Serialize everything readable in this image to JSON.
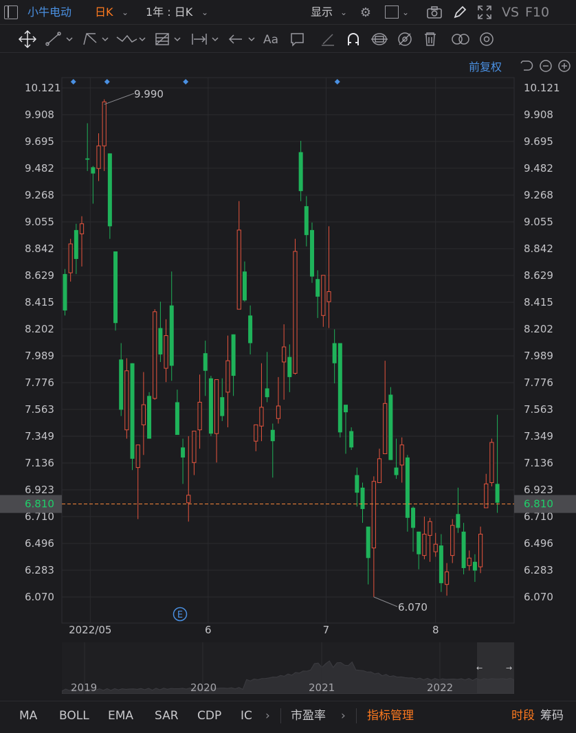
{
  "header": {
    "stock_name": "小牛电动",
    "period_label": "日K",
    "range_label": "1年 : 日K",
    "display_label": "显示",
    "vs_label": "VS",
    "f10_label": "F10",
    "adjust_label": "前复权"
  },
  "footer": {
    "tabs": [
      "MA",
      "BOLL",
      "EMA",
      "SAR",
      "CDP",
      "IC"
    ],
    "pe_label": "市盈率",
    "indicator_mgmt": "指标管理",
    "time_share": "时段",
    "chips": "筹码"
  },
  "navigator": {
    "year_labels": [
      "2019",
      "2020",
      "2021",
      "2022"
    ]
  },
  "colors": {
    "up": "#e8553e",
    "down": "#1fb35a",
    "price_line": "#ff8a3d",
    "accent": "#4a90e2"
  },
  "chart_data": {
    "type": "candlestick",
    "y_ticks": [
      "10.121",
      "9.908",
      "9.695",
      "9.482",
      "9.268",
      "9.055",
      "8.842",
      "8.629",
      "8.415",
      "8.202",
      "7.989",
      "7.776",
      "7.563",
      "7.349",
      "7.136",
      "6.923",
      "6.710",
      "6.496",
      "6.283",
      "6.070"
    ],
    "ylim": [
      5.88,
      10.17
    ],
    "x_labels": [
      "2022/05",
      "6",
      "7",
      "8"
    ],
    "x_label_index": [
      4.5,
      25.5,
      46.5,
      66
    ],
    "current_price": "6.810",
    "current_value": 6.81,
    "high_label": "9.990",
    "high_index": 7,
    "high_value": 9.99,
    "low_label": "6.070",
    "low_index": 55,
    "low_value": 6.07,
    "event_marker": "E",
    "event_index": 20.5,
    "dividend_markers": [
      1.5,
      7.5,
      21.5,
      48.5
    ],
    "candles": [
      [
        8.64,
        8.35,
        8.68,
        8.31
      ],
      [
        8.65,
        8.88,
        8.92,
        8.58
      ],
      [
        8.99,
        8.76,
        9.04,
        8.64
      ],
      [
        8.96,
        9.04,
        9.1,
        8.7
      ],
      [
        9.56,
        9.55,
        9.84,
        9.46
      ],
      [
        9.49,
        9.44,
        9.5,
        9.2
      ],
      [
        9.48,
        9.66,
        9.76,
        9.38
      ],
      [
        9.66,
        10.01,
        10.03,
        9.46
      ],
      [
        9.6,
        9.02,
        9.6,
        8.92
      ],
      [
        8.82,
        8.25,
        8.82,
        8.19
      ],
      [
        7.96,
        7.56,
        8.09,
        7.51
      ],
      [
        7.4,
        7.87,
        7.97,
        7.33
      ],
      [
        7.93,
        7.17,
        7.93,
        7.08
      ],
      [
        7.1,
        7.28,
        7.28,
        6.69
      ],
      [
        7.44,
        7.6,
        7.86,
        7.2
      ],
      [
        7.67,
        7.33,
        7.7,
        7.33
      ],
      [
        7.65,
        8.34,
        8.36,
        7.64
      ],
      [
        8.21,
        8.0,
        8.42,
        7.94
      ],
      [
        7.89,
        8.15,
        8.28,
        7.78
      ],
      [
        8.39,
        7.91,
        8.66,
        7.79
      ],
      [
        7.62,
        7.36,
        7.72,
        7.36
      ],
      [
        7.26,
        7.18,
        7.33,
        6.97
      ],
      [
        6.82,
        6.88,
        7.35,
        6.67
      ],
      [
        7.14,
        7.39,
        7.39,
        7.04
      ],
      [
        7.4,
        7.62,
        7.84,
        7.25
      ],
      [
        8.01,
        7.87,
        8.11,
        7.67
      ],
      [
        7.81,
        7.37,
        7.83,
        7.35
      ],
      [
        7.37,
        7.8,
        7.8,
        7.14
      ],
      [
        7.66,
        7.51,
        7.81,
        7.47
      ],
      [
        7.7,
        7.95,
        8.15,
        7.42
      ],
      [
        8.16,
        7.83,
        8.16,
        7.67
      ],
      [
        8.36,
        8.99,
        9.22,
        8.36
      ],
      [
        8.66,
        8.43,
        8.74,
        8.42
      ],
      [
        8.31,
        8.09,
        8.39,
        8.0
      ],
      [
        7.31,
        7.44,
        7.44,
        7.23
      ],
      [
        7.43,
        7.58,
        7.93,
        7.31
      ],
      [
        7.73,
        7.66,
        8.02,
        7.62
      ],
      [
        7.4,
        7.31,
        7.45,
        7.02
      ],
      [
        7.49,
        7.59,
        7.82,
        7.45
      ],
      [
        7.94,
        8.06,
        8.24,
        7.64
      ],
      [
        7.98,
        7.82,
        8.08,
        7.7
      ],
      [
        7.85,
        8.82,
        8.92,
        7.84
      ],
      [
        9.61,
        9.3,
        9.7,
        9.22
      ],
      [
        9.18,
        8.95,
        9.26,
        8.86
      ],
      [
        8.99,
        8.62,
        9.05,
        8.57
      ],
      [
        8.6,
        8.46,
        8.67,
        8.29
      ],
      [
        8.31,
        8.63,
        8.63,
        8.22
      ],
      [
        8.42,
        8.5,
        9.02,
        8.21
      ],
      [
        8.09,
        7.93,
        8.2,
        7.77
      ],
      [
        8.09,
        7.38,
        8.09,
        7.34
      ],
      [
        7.6,
        7.54,
        7.58,
        7.21
      ],
      [
        7.39,
        7.26,
        7.42,
        7.24
      ],
      [
        7.04,
        6.9,
        7.1,
        6.79
      ],
      [
        6.94,
        6.77,
        6.98,
        6.66
      ],
      [
        6.63,
        6.38,
        6.63,
        6.17
      ],
      [
        6.46,
        6.99,
        7.03,
        6.07
      ],
      [
        6.98,
        7.17,
        7.25,
        6.98
      ],
      [
        7.21,
        7.61,
        7.95,
        7.21
      ],
      [
        7.68,
        7.16,
        7.74,
        7.16
      ],
      [
        7.1,
        7.04,
        7.33,
        7.01
      ],
      [
        7.12,
        7.28,
        7.34,
        6.98
      ],
      [
        7.18,
        6.7,
        7.2,
        6.59
      ],
      [
        6.78,
        6.62,
        6.79,
        6.43
      ],
      [
        6.59,
        6.41,
        6.59,
        6.29
      ],
      [
        6.4,
        6.57,
        6.71,
        6.37
      ],
      [
        6.56,
        6.67,
        6.7,
        6.35
      ],
      [
        6.43,
        6.49,
        6.58,
        6.39
      ],
      [
        6.48,
        6.18,
        6.57,
        6.11
      ],
      [
        6.17,
        6.27,
        6.34,
        6.08
      ],
      [
        6.4,
        6.64,
        6.69,
        6.34
      ],
      [
        6.73,
        6.62,
        6.94,
        6.58
      ],
      [
        6.59,
        6.3,
        6.66,
        6.25
      ],
      [
        6.32,
        6.38,
        6.44,
        6.28
      ],
      [
        6.35,
        6.28,
        6.41,
        6.19
      ],
      [
        6.31,
        6.57,
        6.63,
        6.26
      ],
      [
        6.78,
        6.97,
        7.05,
        6.78
      ],
      [
        6.98,
        7.3,
        7.33,
        6.95
      ],
      [
        6.97,
        6.82,
        7.52,
        6.74
      ]
    ]
  }
}
